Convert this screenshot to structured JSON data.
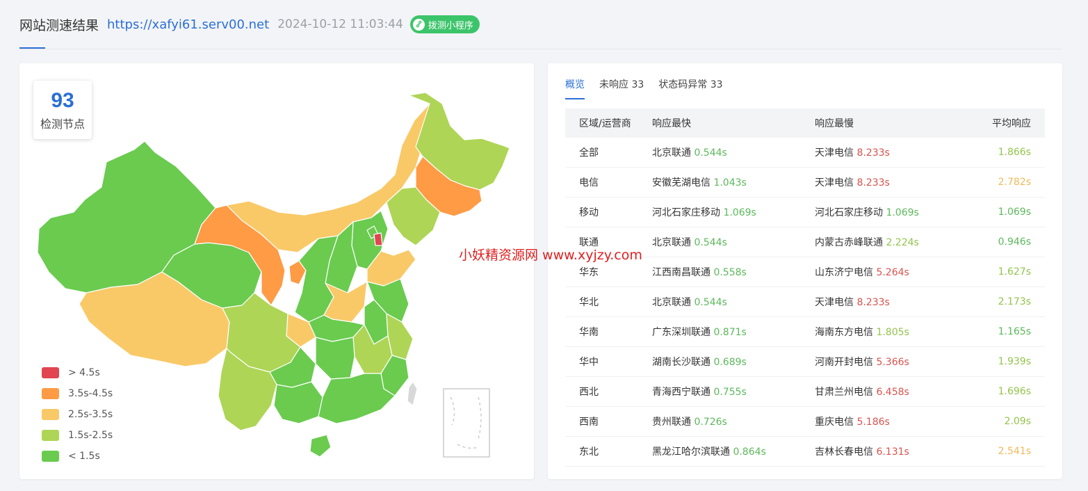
{
  "header": {
    "title": "网站测速结果",
    "url": "https://xafyi61.serv00.net",
    "datetime": "2024-10-12 11:03:44",
    "badge_label": "拨测小程序",
    "badge_icon": "link-icon"
  },
  "map": {
    "node_count": "93",
    "node_label": "检测节点",
    "legend": [
      {
        "label": "> 4.5s",
        "color": "#e04550"
      },
      {
        "label": "3.5s-4.5s",
        "color": "#ff9a45"
      },
      {
        "label": "2.5s-3.5s",
        "color": "#f9c968"
      },
      {
        "label": "1.5s-2.5s",
        "color": "#aed556"
      },
      {
        "label": "< 1.5s",
        "color": "#6acb4f"
      }
    ]
  },
  "watermark": "小妖精资源网 www.xyjzy.com",
  "tabs": [
    {
      "label": "概览",
      "active": true
    },
    {
      "label": "未响应 33",
      "active": false
    },
    {
      "label": "状态码异常 33",
      "active": false
    }
  ],
  "table": {
    "headers": [
      "区域/运营商",
      "响应最快",
      "响应最慢",
      "平均响应"
    ],
    "rows": [
      {
        "region": "全部",
        "fast_name": "北京联通",
        "fast_time": "0.544s",
        "slow_name": "天津电信",
        "slow_time": "8.233s",
        "avg": "1.866s"
      },
      {
        "region": "电信",
        "fast_name": "安徽芜湖电信",
        "fast_time": "1.043s",
        "slow_name": "天津电信",
        "slow_time": "8.233s",
        "avg": "2.782s"
      },
      {
        "region": "移动",
        "fast_name": "河北石家庄移动",
        "fast_time": "1.069s",
        "slow_name": "河北石家庄移动",
        "slow_time": "1.069s",
        "avg": "1.069s"
      },
      {
        "region": "联通",
        "fast_name": "北京联通",
        "fast_time": "0.544s",
        "slow_name": "内蒙古赤峰联通",
        "slow_time": "2.224s",
        "avg": "0.946s"
      },
      {
        "region": "华东",
        "fast_name": "江西南昌联通",
        "fast_time": "0.558s",
        "slow_name": "山东济宁电信",
        "slow_time": "5.264s",
        "avg": "1.627s"
      },
      {
        "region": "华北",
        "fast_name": "北京联通",
        "fast_time": "0.544s",
        "slow_name": "天津电信",
        "slow_time": "8.233s",
        "avg": "2.173s"
      },
      {
        "region": "华南",
        "fast_name": "广东深圳联通",
        "fast_time": "0.871s",
        "slow_name": "海南东方电信",
        "slow_time": "1.805s",
        "avg": "1.165s"
      },
      {
        "region": "华中",
        "fast_name": "湖南长沙联通",
        "fast_time": "0.689s",
        "slow_name": "河南开封电信",
        "slow_time": "5.366s",
        "avg": "1.939s"
      },
      {
        "region": "西北",
        "fast_name": "青海西宁联通",
        "fast_time": "0.755s",
        "slow_name": "甘肃兰州电信",
        "slow_time": "6.458s",
        "avg": "1.696s"
      },
      {
        "region": "西南",
        "fast_name": "贵州联通",
        "fast_time": "0.726s",
        "slow_name": "重庆电信",
        "slow_time": "5.186s",
        "avg": "2.09s"
      },
      {
        "region": "东北",
        "fast_name": "黑龙江哈尔滨联通",
        "fast_time": "0.864s",
        "slow_name": "吉林长春电信",
        "slow_time": "6.131s",
        "avg": "2.541s"
      }
    ]
  }
}
